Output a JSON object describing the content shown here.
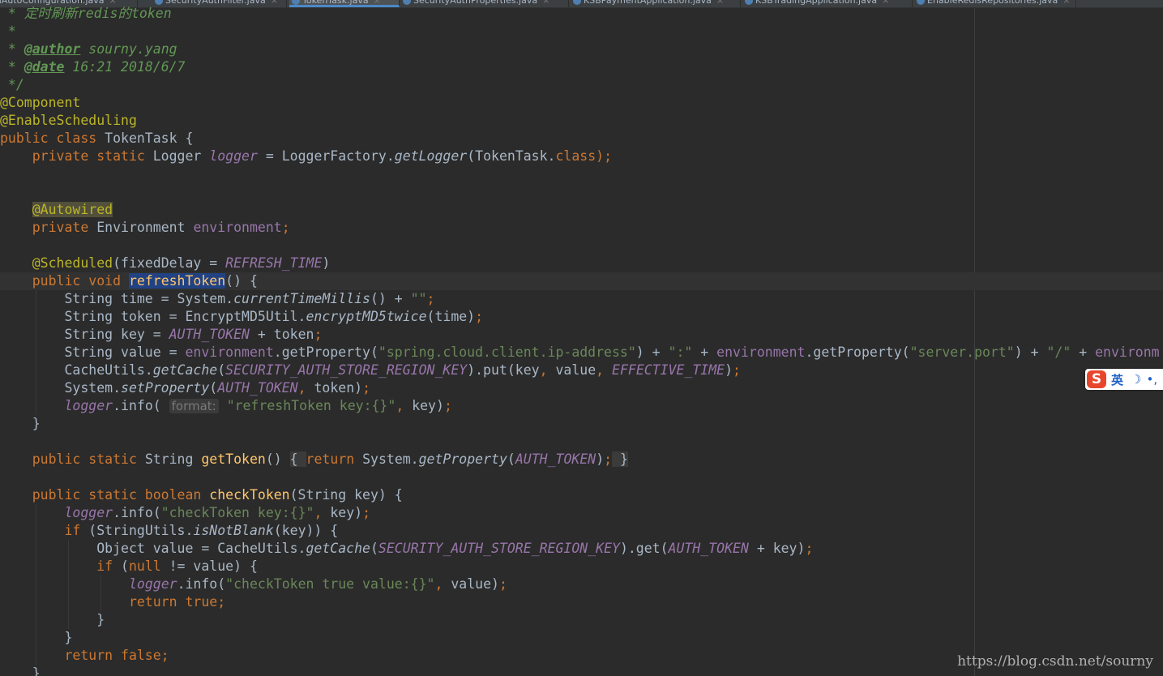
{
  "editor": {
    "tabs": [
      {
        "label": "AuthAutoConfiguration.java",
        "active": false
      },
      {
        "label": "SecurityAuthFilter.java",
        "active": false
      },
      {
        "label": "TokenTask.java",
        "active": true
      },
      {
        "label": "SecurityAuthProperties.java",
        "active": false
      },
      {
        "label": "KSBPaymentApplication.java",
        "active": false
      },
      {
        "label": "KSBTradingApplication.java",
        "active": false
      },
      {
        "label": "EnableRedisRepositories.java",
        "active": false
      }
    ],
    "lines": [
      {
        "indent": 0,
        "tokens": [
          {
            "t": " * 定时刷新redis的token",
            "c": "comment"
          }
        ]
      },
      {
        "indent": 0,
        "tokens": [
          {
            "t": " *",
            "c": "comment"
          }
        ]
      },
      {
        "indent": 0,
        "tokens": [
          {
            "t": " * ",
            "c": "comment"
          },
          {
            "t": "@author",
            "c": "doc-tag"
          },
          {
            "t": " sourny.yang",
            "c": "comment"
          }
        ]
      },
      {
        "indent": 0,
        "tokens": [
          {
            "t": " * ",
            "c": "comment"
          },
          {
            "t": "@date",
            "c": "doc-tag"
          },
          {
            "t": " 16:21 2018/6/7",
            "c": "comment"
          }
        ]
      },
      {
        "indent": 0,
        "tokens": [
          {
            "t": " */",
            "c": "comment"
          }
        ]
      },
      {
        "indent": 0,
        "tokens": [
          {
            "t": "@Component",
            "c": "annotation"
          }
        ]
      },
      {
        "indent": 0,
        "tokens": [
          {
            "t": "@EnableScheduling",
            "c": "annotation"
          }
        ]
      },
      {
        "indent": 0,
        "tokens": [
          {
            "t": "public class ",
            "c": "keyword"
          },
          {
            "t": "TokenTask {",
            "c": "plain"
          }
        ]
      },
      {
        "indent": 0,
        "tokens": [
          {
            "t": "    private static ",
            "c": "keyword"
          },
          {
            "t": "Logger ",
            "c": "plain"
          },
          {
            "t": "logger",
            "c": "static-field"
          },
          {
            "t": " = LoggerFactory.",
            "c": "plain"
          },
          {
            "t": "getLogger",
            "c": "static-method"
          },
          {
            "t": "(TokenTask.",
            "c": "plain"
          },
          {
            "t": "class",
            "c": "keyword"
          },
          {
            "t": ");",
            "c": "keyword"
          }
        ]
      },
      {
        "indent": 0,
        "tokens": [
          {
            "t": "",
            "c": "plain"
          }
        ]
      },
      {
        "indent": 0,
        "tokens": [
          {
            "t": "",
            "c": "plain"
          }
        ]
      },
      {
        "indent": 0,
        "tokens": [
          {
            "t": "    ",
            "c": "plain"
          },
          {
            "t": "@Autowired",
            "c": "annotation-hl"
          }
        ]
      },
      {
        "indent": 0,
        "tokens": [
          {
            "t": "    private ",
            "c": "keyword"
          },
          {
            "t": "Environment ",
            "c": "plain"
          },
          {
            "t": "environment",
            "c": "field"
          },
          {
            "t": ";",
            "c": "keyword"
          }
        ]
      },
      {
        "indent": 0,
        "tokens": [
          {
            "t": "",
            "c": "plain"
          }
        ]
      },
      {
        "indent": 0,
        "tokens": [
          {
            "t": "    ",
            "c": "plain"
          },
          {
            "t": "@Scheduled",
            "c": "annotation"
          },
          {
            "t": "(fixedDelay = ",
            "c": "plain"
          },
          {
            "t": "REFRESH_TIME",
            "c": "static-field"
          },
          {
            "t": ")",
            "c": "plain"
          }
        ]
      },
      {
        "indent": 0,
        "current": true,
        "tokens": [
          {
            "t": "    public void ",
            "c": "keyword"
          },
          {
            "t": "refreshToken",
            "c": "method-decl-sel"
          },
          {
            "t": "() {",
            "c": "plain"
          }
        ]
      },
      {
        "indent": 1,
        "tokens": [
          {
            "t": "        String time = System.",
            "c": "plain"
          },
          {
            "t": "currentTimeMillis",
            "c": "static-method"
          },
          {
            "t": "() + ",
            "c": "plain"
          },
          {
            "t": "\"\"",
            "c": "string"
          },
          {
            "t": ";",
            "c": "keyword"
          }
        ]
      },
      {
        "indent": 1,
        "tokens": [
          {
            "t": "        String token = EncryptMD5Util.",
            "c": "plain"
          },
          {
            "t": "encryptMD5twice",
            "c": "static-method"
          },
          {
            "t": "(time)",
            "c": "plain"
          },
          {
            "t": ";",
            "c": "keyword"
          }
        ]
      },
      {
        "indent": 1,
        "tokens": [
          {
            "t": "        String key = ",
            "c": "plain"
          },
          {
            "t": "AUTH_TOKEN",
            "c": "static-field"
          },
          {
            "t": " + token",
            "c": "plain"
          },
          {
            "t": ";",
            "c": "keyword"
          }
        ]
      },
      {
        "indent": 1,
        "tokens": [
          {
            "t": "        String value = ",
            "c": "plain"
          },
          {
            "t": "environment",
            "c": "field"
          },
          {
            "t": ".getProperty(",
            "c": "plain"
          },
          {
            "t": "\"spring.cloud.client.ip-address\"",
            "c": "string"
          },
          {
            "t": ") + ",
            "c": "plain"
          },
          {
            "t": "\":\"",
            "c": "string"
          },
          {
            "t": " + ",
            "c": "plain"
          },
          {
            "t": "environment",
            "c": "field"
          },
          {
            "t": ".getProperty(",
            "c": "plain"
          },
          {
            "t": "\"server.port\"",
            "c": "string"
          },
          {
            "t": ") + ",
            "c": "plain"
          },
          {
            "t": "\"/\"",
            "c": "string"
          },
          {
            "t": " + ",
            "c": "plain"
          },
          {
            "t": "environm",
            "c": "field"
          }
        ]
      },
      {
        "indent": 1,
        "tokens": [
          {
            "t": "        CacheUtils.",
            "c": "plain"
          },
          {
            "t": "getCache",
            "c": "static-method"
          },
          {
            "t": "(",
            "c": "plain"
          },
          {
            "t": "SECURITY_AUTH_STORE_REGION_KEY",
            "c": "static-field"
          },
          {
            "t": ").put(key",
            "c": "plain"
          },
          {
            "t": ", ",
            "c": "keyword"
          },
          {
            "t": "value",
            "c": "plain"
          },
          {
            "t": ", ",
            "c": "keyword"
          },
          {
            "t": "EFFECTIVE_TIME",
            "c": "static-field"
          },
          {
            "t": ")",
            "c": "plain"
          },
          {
            "t": ";",
            "c": "keyword"
          }
        ]
      },
      {
        "indent": 1,
        "tokens": [
          {
            "t": "        System.",
            "c": "plain"
          },
          {
            "t": "setProperty",
            "c": "static-method"
          },
          {
            "t": "(",
            "c": "plain"
          },
          {
            "t": "AUTH_TOKEN",
            "c": "static-field"
          },
          {
            "t": ", ",
            "c": "keyword"
          },
          {
            "t": "token)",
            "c": "plain"
          },
          {
            "t": ";",
            "c": "keyword"
          }
        ]
      },
      {
        "indent": 1,
        "tokens": [
          {
            "t": "        ",
            "c": "plain"
          },
          {
            "t": "logger",
            "c": "static-field"
          },
          {
            "t": ".info( ",
            "c": "plain"
          },
          {
            "t": "format:",
            "c": "hint"
          },
          {
            "t": " ",
            "c": "plain"
          },
          {
            "t": "\"refreshToken key:{}\"",
            "c": "string"
          },
          {
            "t": ", ",
            "c": "keyword"
          },
          {
            "t": "key)",
            "c": "plain"
          },
          {
            "t": ";",
            "c": "keyword"
          }
        ]
      },
      {
        "indent": 0,
        "tokens": [
          {
            "t": "    }",
            "c": "plain"
          }
        ]
      },
      {
        "indent": 0,
        "tokens": [
          {
            "t": "",
            "c": "plain"
          }
        ]
      },
      {
        "indent": 0,
        "tokens": [
          {
            "t": "    public static ",
            "c": "keyword"
          },
          {
            "t": "String ",
            "c": "plain"
          },
          {
            "t": "getToken",
            "c": "method-decl"
          },
          {
            "t": "() ",
            "c": "plain"
          },
          {
            "t": "{ ",
            "c": "fold"
          },
          {
            "t": "return ",
            "c": "keyword"
          },
          {
            "t": "System.",
            "c": "plain"
          },
          {
            "t": "getProperty",
            "c": "static-method"
          },
          {
            "t": "(",
            "c": "plain"
          },
          {
            "t": "AUTH_TOKEN",
            "c": "static-field"
          },
          {
            "t": ")",
            "c": "plain"
          },
          {
            "t": ";",
            "c": "keyword"
          },
          {
            "t": " }",
            "c": "fold"
          }
        ]
      },
      {
        "indent": 0,
        "tokens": [
          {
            "t": "",
            "c": "plain"
          }
        ]
      },
      {
        "indent": 0,
        "tokens": [
          {
            "t": "    public static boolean ",
            "c": "keyword"
          },
          {
            "t": "checkToken",
            "c": "method-decl"
          },
          {
            "t": "(String key) {",
            "c": "plain"
          }
        ]
      },
      {
        "indent": 1,
        "tokens": [
          {
            "t": "        ",
            "c": "plain"
          },
          {
            "t": "logger",
            "c": "static-field"
          },
          {
            "t": ".info(",
            "c": "plain"
          },
          {
            "t": "\"checkToken key:{}\"",
            "c": "string"
          },
          {
            "t": ", ",
            "c": "keyword"
          },
          {
            "t": "key)",
            "c": "plain"
          },
          {
            "t": ";",
            "c": "keyword"
          }
        ]
      },
      {
        "indent": 1,
        "tokens": [
          {
            "t": "        if ",
            "c": "keyword"
          },
          {
            "t": "(StringUtils.",
            "c": "plain"
          },
          {
            "t": "isNotBlank",
            "c": "static-method"
          },
          {
            "t": "(key)) {",
            "c": "plain"
          }
        ]
      },
      {
        "indent": 2,
        "tokens": [
          {
            "t": "            Object value = CacheUtils.",
            "c": "plain"
          },
          {
            "t": "getCache",
            "c": "static-method"
          },
          {
            "t": "(",
            "c": "plain"
          },
          {
            "t": "SECURITY_AUTH_STORE_REGION_KEY",
            "c": "static-field"
          },
          {
            "t": ").get(",
            "c": "plain"
          },
          {
            "t": "AUTH_TOKEN",
            "c": "static-field"
          },
          {
            "t": " + key)",
            "c": "plain"
          },
          {
            "t": ";",
            "c": "keyword"
          }
        ]
      },
      {
        "indent": 2,
        "tokens": [
          {
            "t": "            if ",
            "c": "keyword"
          },
          {
            "t": "(",
            "c": "plain"
          },
          {
            "t": "null ",
            "c": "keyword"
          },
          {
            "t": "!= value) {",
            "c": "plain"
          }
        ]
      },
      {
        "indent": 3,
        "tokens": [
          {
            "t": "                ",
            "c": "plain"
          },
          {
            "t": "logger",
            "c": "static-field"
          },
          {
            "t": ".info(",
            "c": "plain"
          },
          {
            "t": "\"checkToken true value:{}\"",
            "c": "string"
          },
          {
            "t": ", ",
            "c": "keyword"
          },
          {
            "t": "value)",
            "c": "plain"
          },
          {
            "t": ";",
            "c": "keyword"
          }
        ]
      },
      {
        "indent": 3,
        "tokens": [
          {
            "t": "                return true;",
            "c": "keyword"
          }
        ]
      },
      {
        "indent": 2,
        "tokens": [
          {
            "t": "            }",
            "c": "plain"
          }
        ]
      },
      {
        "indent": 1,
        "tokens": [
          {
            "t": "        }",
            "c": "plain"
          }
        ]
      },
      {
        "indent": 1,
        "tokens": [
          {
            "t": "        return false;",
            "c": "keyword"
          }
        ]
      },
      {
        "indent": 0,
        "tokens": [
          {
            "t": "    }",
            "c": "plain"
          }
        ]
      }
    ]
  },
  "ime": {
    "logo": "S",
    "lang": "英",
    "moon": "☽",
    "dot": "•,"
  },
  "watermark": {
    "text": "https://blog.csdn.net/sourny"
  }
}
